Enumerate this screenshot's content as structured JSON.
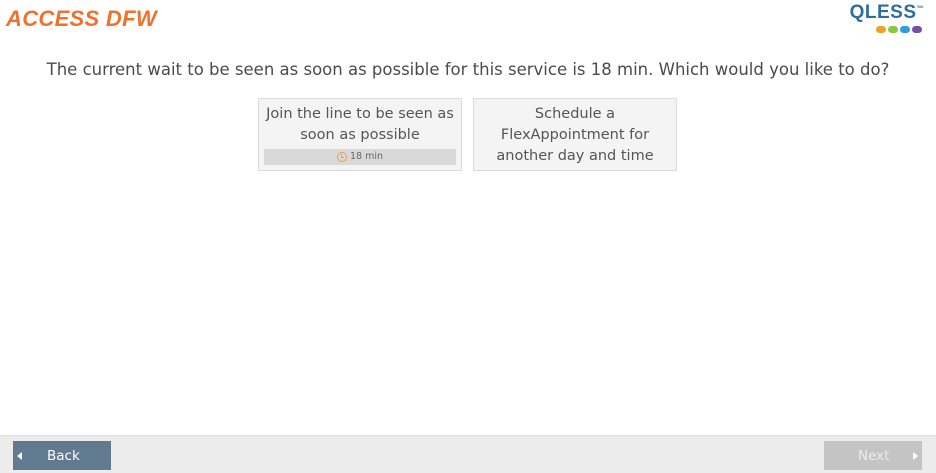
{
  "header": {
    "title": "ACCESS DFW",
    "logo_text": "QLESS",
    "logo_tm": "™",
    "logo_dot_colors": [
      "#f0a12c",
      "#8dc63f",
      "#2e9fd8",
      "#7b4fa0"
    ],
    "brand_color": "#f0712c"
  },
  "main": {
    "prompt": "The current wait to be seen as soon as possible for this service is 18 min. Which would you like to do?",
    "options": [
      {
        "label": "Join the line to be seen as soon as possible",
        "wait": "18 min"
      },
      {
        "label": "Schedule a FlexAppointment for another day and time"
      }
    ]
  },
  "footer": {
    "back_label": "Back",
    "next_label": "Next"
  }
}
